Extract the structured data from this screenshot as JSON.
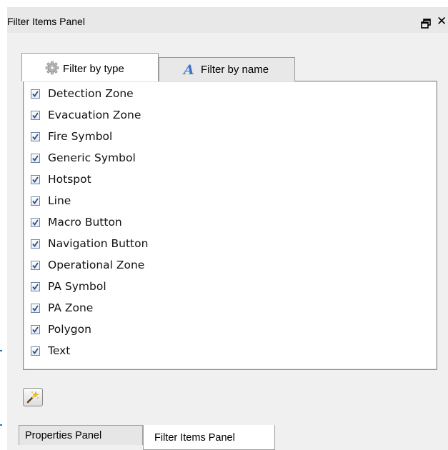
{
  "panel": {
    "title": "Filter Items Panel",
    "float_icon": "float-window-icon",
    "close_label": "✕"
  },
  "tabs": [
    {
      "label": "Filter by type",
      "icon": "gear-icon",
      "active": true
    },
    {
      "label": "Filter by name",
      "icon": "font-a-icon",
      "active": false
    }
  ],
  "filter_items": [
    {
      "label": "Detection Zone",
      "checked": true
    },
    {
      "label": "Evacuation Zone",
      "checked": true
    },
    {
      "label": "Fire Symbol",
      "checked": true
    },
    {
      "label": "Generic Symbol",
      "checked": true
    },
    {
      "label": "Hotspot",
      "checked": true
    },
    {
      "label": "Line",
      "checked": true
    },
    {
      "label": "Macro Button",
      "checked": true
    },
    {
      "label": "Navigation Button",
      "checked": true
    },
    {
      "label": "Operational Zone",
      "checked": true
    },
    {
      "label": "PA Symbol",
      "checked": true
    },
    {
      "label": "PA Zone",
      "checked": true
    },
    {
      "label": "Polygon",
      "checked": true
    },
    {
      "label": "Text",
      "checked": true
    }
  ],
  "actions": {
    "wand_icon": "magic-wand-icon"
  },
  "bottom_tabs": [
    {
      "label": "Properties Panel",
      "active": false
    },
    {
      "label": "Filter Items Panel",
      "active": true
    }
  ],
  "colors": {
    "panel_bg": "#f0f0f0",
    "accent": "#3f73c9",
    "checkbox_check": "#2a4f8a"
  }
}
